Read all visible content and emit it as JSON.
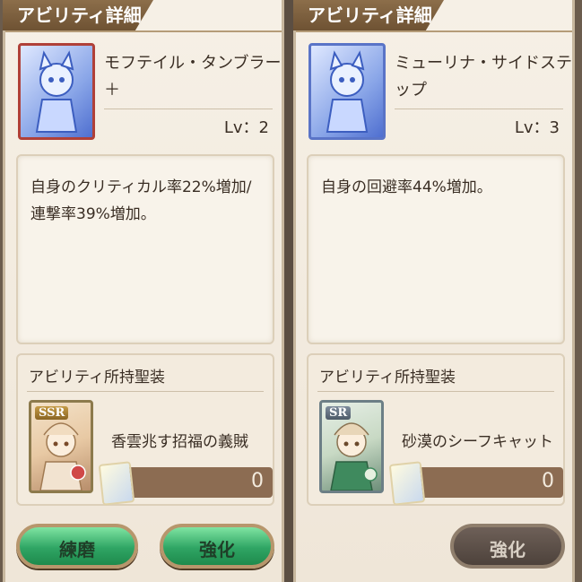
{
  "left": {
    "title": "アビリティ詳細",
    "ability_name": "モフテイル・タンブラー＋",
    "level": "Lv：2",
    "description": "自身のクリティカル率22%増加/連撃率39%増加。",
    "gear_header": "アビリティ所持聖装",
    "gear_rarity": "SSR",
    "gear_name": "香雲兆す招福の義賊",
    "gear_count": "0",
    "buttons": {
      "train": "練磨",
      "enhance": "強化"
    }
  },
  "right": {
    "title": "アビリティ詳細",
    "ability_name": "ミューリナ・サイドステップ",
    "level": "Lv：3",
    "description": "自身の回避率44%増加。",
    "gear_header": "アビリティ所持聖装",
    "gear_rarity": "SR",
    "gear_name": "砂漠のシーフキャット",
    "gear_count": "0",
    "buttons": {
      "enhance": "強化"
    }
  },
  "colors": {
    "panel_bg": "#f6f0e6",
    "title_tab": "#7a5c3a",
    "button_green": "#2fa564",
    "button_disabled": "#5a4d45",
    "gear_bar": "#8c6c52"
  },
  "icons": {
    "ability_card": "blue-card-icon",
    "gear_mini": "gear-card-mini-icon"
  }
}
